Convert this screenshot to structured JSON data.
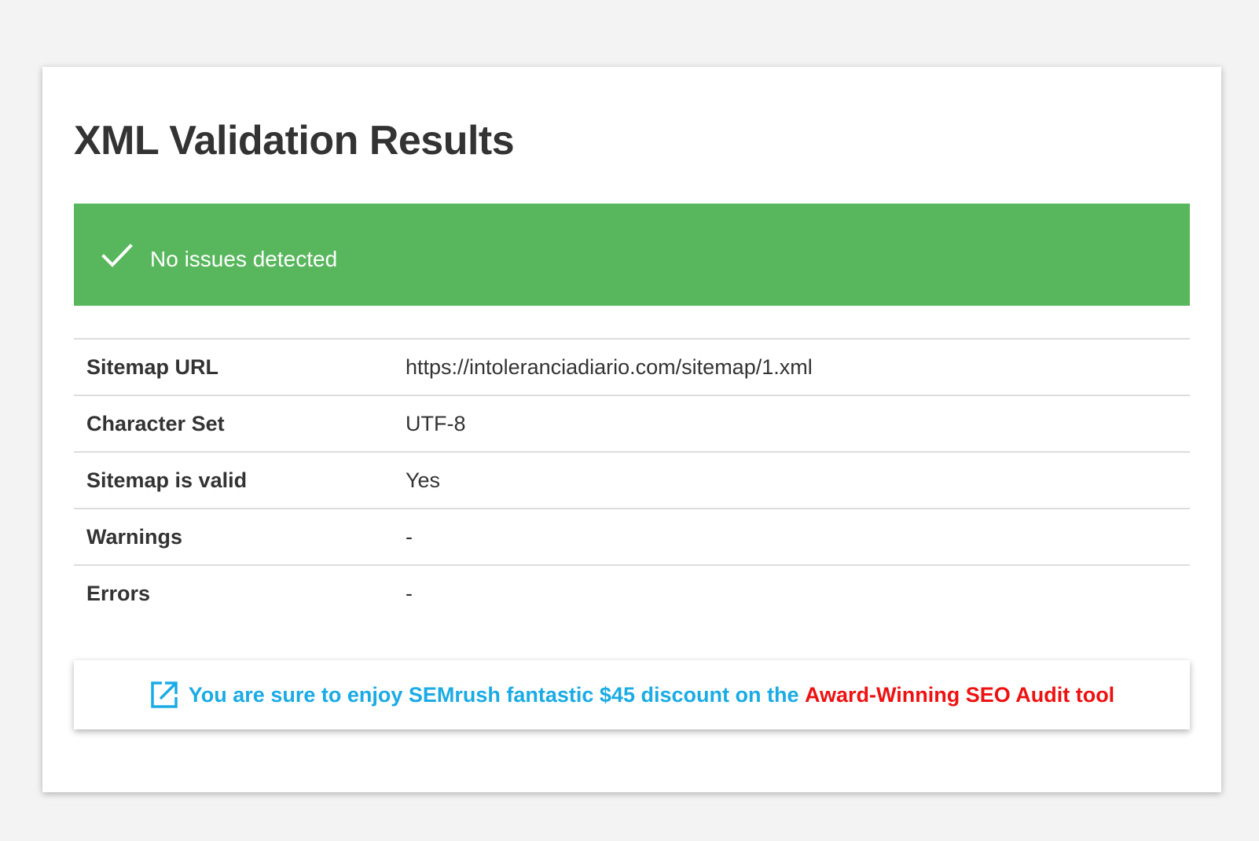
{
  "page": {
    "title": "XML Validation Results"
  },
  "alert": {
    "icon": "check-icon",
    "message": "No issues detected",
    "color": "#58b75c"
  },
  "results": {
    "rows": [
      {
        "label": "Sitemap URL",
        "value": "https://intoleranciadiario.com/sitemap/1.xml"
      },
      {
        "label": "Character Set",
        "value": "UTF-8"
      },
      {
        "label": "Sitemap is valid",
        "value": "Yes"
      },
      {
        "label": "Warnings",
        "value": "-"
      },
      {
        "label": "Errors",
        "value": "-"
      }
    ]
  },
  "promo": {
    "icon": "external-link-icon",
    "text": "You are sure to enjoy SEMrush fantastic $45 discount on the ",
    "highlight": "Award-Winning SEO Audit tool",
    "text_color": "#1aabe5",
    "highlight_color": "#ee1111"
  }
}
